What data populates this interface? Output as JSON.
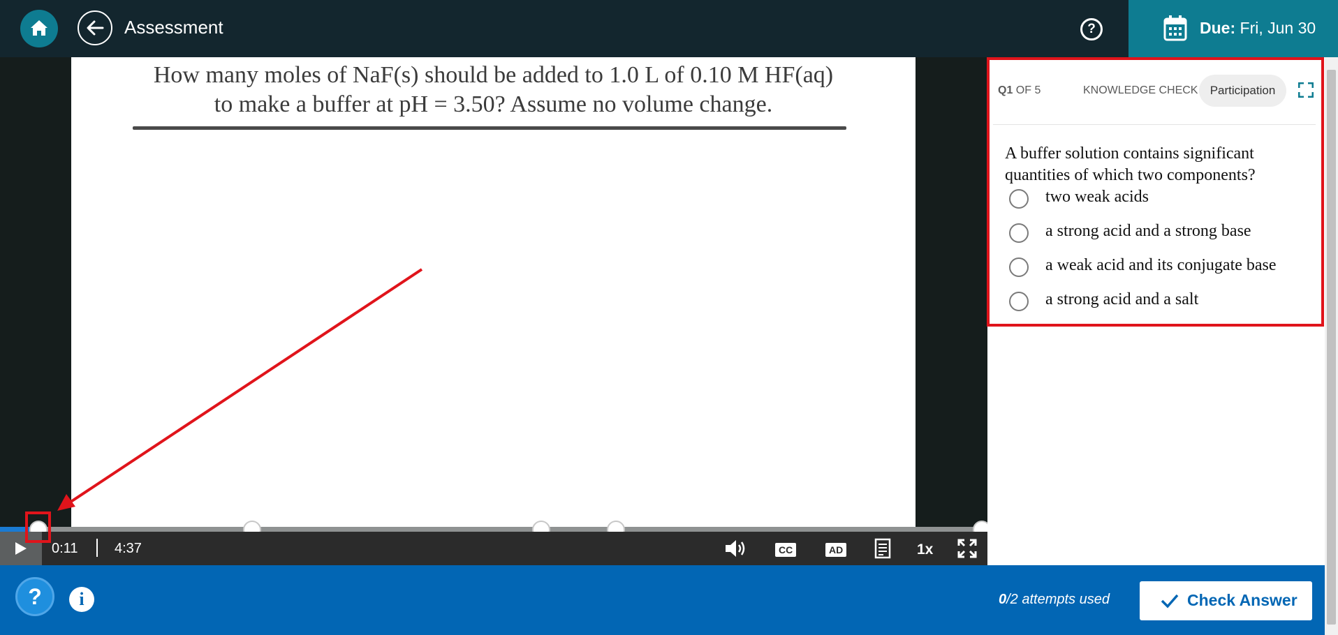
{
  "header": {
    "title": "Assessment",
    "help_label": "?",
    "due_label": "Due:",
    "due_date": "Fri, Jun 30"
  },
  "video": {
    "slide_line1": "How many moles of NaF(s) should be added to 1.0 L of 0.10 M HF(aq)",
    "slide_line2": "to make a buffer at pH = 3.50? Assume no volume change.",
    "current_time": "0:11",
    "duration": "4:37",
    "cc_label": "CC",
    "ad_label": "AD",
    "speed_label": "1x"
  },
  "question": {
    "number": "Q1",
    "of_total": "OF 5",
    "kind": "KNOWLEDGE CHECK",
    "tag": "Participation",
    "text": "A buffer solution contains significant quantities of which two components?",
    "options": [
      "two weak acids",
      "a strong acid and a strong base",
      "a weak acid and its conjugate base",
      "a strong acid and a salt"
    ]
  },
  "footer": {
    "help_label": "?",
    "info_label": "i",
    "attempts_used": "0",
    "attempts_rest": "/2 attempts used",
    "check_label": "Check Answer"
  },
  "colors": {
    "topbar": "#13262e",
    "teal": "#0e7c91",
    "footer_blue": "#0266b4",
    "annotation_red": "#e0141b"
  }
}
